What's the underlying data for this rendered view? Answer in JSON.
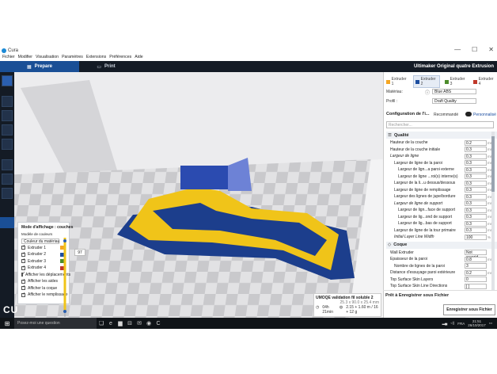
{
  "window": {
    "title": "Cura",
    "controls": [
      "—",
      "☐",
      "✕"
    ]
  },
  "menu": [
    "Fichier",
    "Modifier",
    "Visualisation",
    "Paramètres",
    "Extensions",
    "Préférences",
    "Aide"
  ],
  "header": {
    "tab_prepare": "Prepare",
    "tab_print": "Print",
    "printer": "Ultimaker Original quatre Extrusion"
  },
  "extruders": [
    {
      "label": "Extruder 1",
      "color": "#f5a623"
    },
    {
      "label": "Extruder 2",
      "color": "#1c4ea0",
      "active": true
    },
    {
      "label": "Extruder 3",
      "color": "#4c8c2b"
    },
    {
      "label": "Extruder 4",
      "color": "#c0392b"
    }
  ],
  "material": {
    "label": "Matériau:",
    "value": "Blue ABS"
  },
  "profile": {
    "label": "Profil :",
    "value": "Draft Quality"
  },
  "config": {
    "title": "Configuration de l'i...",
    "recommended": "Recommandé",
    "custom": "Personnalisé",
    "search_placeholder": "Rechercher..."
  },
  "quality_section": "Qualité",
  "quality_settings": [
    {
      "label": "Hauteur de la couche",
      "value": "0.2",
      "unit": "mm",
      "indent": 1
    },
    {
      "label": "Hauteur de la couche initiale",
      "value": "0.3",
      "unit": "mm",
      "indent": 1
    },
    {
      "label": "Largeur de ligne",
      "value": "0.3",
      "unit": "mm",
      "indent": 1,
      "italic": true
    },
    {
      "label": "Largeur de ligne de la paroi",
      "value": "0.3",
      "unit": "mm",
      "indent": 2
    },
    {
      "label": "Largeur de lign...a paroi externe",
      "value": "0.3",
      "unit": "mm",
      "indent": 3
    },
    {
      "label": "Largeur de ligne ...roi(s) interne(s)",
      "value": "0.3",
      "unit": "mm",
      "indent": 3
    },
    {
      "label": "Largeur de la li...u dessus/dessous",
      "value": "0.3",
      "unit": "mm",
      "indent": 2
    },
    {
      "label": "Largeur de ligne de remplissage",
      "value": "0.3",
      "unit": "mm",
      "indent": 2
    },
    {
      "label": "Largeur des lignes de jupe/bordure",
      "value": "0.3",
      "unit": "mm",
      "indent": 2
    },
    {
      "label": "Largeur de ligne de support",
      "value": "0.3",
      "unit": "mm",
      "indent": 2,
      "italic": true
    },
    {
      "label": "Largeur de lign...face de support",
      "value": "0.3",
      "unit": "mm",
      "indent": 3
    },
    {
      "label": "Largeur de lig...ond de support",
      "value": "0.3",
      "unit": "mm",
      "indent": 3
    },
    {
      "label": "Largeur de lig...bas de support",
      "value": "0.3",
      "unit": "mm",
      "indent": 3
    },
    {
      "label": "Largeur de ligne de la tour primaire",
      "value": "0.3",
      "unit": "mm",
      "indent": 2
    },
    {
      "label": "Initial Layer Line Width",
      "value": "100",
      "unit": "%",
      "indent": 2,
      "italic": true
    }
  ],
  "shell_section": "Coque",
  "shell_settings": [
    {
      "label": "Wall Extruder",
      "value": "Not overrid...",
      "unit": "",
      "indent": 1
    },
    {
      "label": "Épaisseur de la paroi",
      "value": "0.8",
      "unit": "mm",
      "indent": 1
    },
    {
      "label": "Nombre de lignes de la paroi",
      "value": "3",
      "unit": "",
      "indent": 2
    },
    {
      "label": "Distance d'essuyage paroi extérieure",
      "value": "0.2",
      "unit": "mm",
      "indent": 1
    },
    {
      "label": "Top Surface Skin Layers",
      "value": "0",
      "unit": "",
      "indent": 1
    },
    {
      "label": "Top Surface Skin Line Directions",
      "value": "[ ]",
      "unit": "",
      "indent": 1
    }
  ],
  "ready": {
    "text": "Prêt à Enregistrer sous Fichier",
    "save_button": "Enregistrer sous Fichier"
  },
  "view_popup": {
    "mode_label": "Mode d'affichage : couches",
    "color_label": "Modèle de couleurs",
    "color_value": "Couleur du matériau",
    "layer": "97",
    "items": [
      {
        "label": "Extruder 1",
        "checked": true,
        "color": "#f5a623"
      },
      {
        "label": "Extruder 2",
        "checked": true,
        "color": "#1c4ea0"
      },
      {
        "label": "Extruder 3",
        "checked": true,
        "color": "#4c8c2b"
      },
      {
        "label": "Extruder 4",
        "checked": true,
        "color": "#c0392b"
      },
      {
        "label": "Afficher les déplacements",
        "checked": true
      },
      {
        "label": "Afficher les aides",
        "checked": true
      },
      {
        "label": "Afficher la coque",
        "checked": true
      },
      {
        "label": "Afficher le remplissage",
        "checked": true
      }
    ]
  },
  "job": {
    "name": "UMOQE validation fil soluble 2",
    "dims": "25.3 x 90.0 x 25.4 mm",
    "time": "04h 21min",
    "material": "2.15 + 1.60 m / 16 + 12 g"
  },
  "brand": "CU",
  "taskbar": {
    "search": "Posez-moi une question",
    "lang": "FRA",
    "time": "21:51",
    "date": "26/10/2017"
  }
}
